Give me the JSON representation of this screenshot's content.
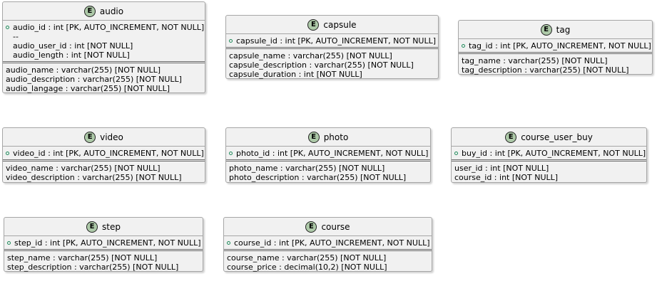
{
  "entities": {
    "audio": {
      "name": "audio",
      "badge": "E",
      "key_fields": [
        "audio_id : int [PK, AUTO_INCREMENT, NOT NULL]"
      ],
      "key_extra": [
        "--",
        "audio_user_id : int [NOT NULL]",
        "audio_length : int [NOT NULL]"
      ],
      "fields": [
        "audio_name : varchar(255) [NOT NULL]",
        "audio_description : varchar(255) [NOT NULL]",
        "audio_langage : varchar(255) [NOT NULL]"
      ]
    },
    "capsule": {
      "name": "capsule",
      "badge": "E",
      "key_fields": [
        "capsule_id : int [PK, AUTO_INCREMENT, NOT NULL]"
      ],
      "fields": [
        "capsule_name : varchar(255) [NOT NULL]",
        "capsule_description : varchar(255) [NOT NULL]",
        "capsule_duration : int [NOT NULL]"
      ]
    },
    "tag": {
      "name": "tag",
      "badge": "E",
      "key_fields": [
        "tag_id : int [PK, AUTO_INCREMENT, NOT NULL]"
      ],
      "fields": [
        "tag_name : varchar(255) [NOT NULL]",
        "tag_description : varchar(255) [NOT NULL]"
      ]
    },
    "video": {
      "name": "video",
      "badge": "E",
      "key_fields": [
        "video_id : int [PK, AUTO_INCREMENT, NOT NULL]"
      ],
      "fields": [
        "video_name : varchar(255) [NOT NULL]",
        "video_description : varchar(255) [NOT NULL]"
      ]
    },
    "photo": {
      "name": "photo",
      "badge": "E",
      "key_fields": [
        "photo_id : int [PK, AUTO_INCREMENT, NOT NULL]"
      ],
      "fields": [
        "photo_name : varchar(255) [NOT NULL]",
        "photo_description : varchar(255) [NOT NULL]"
      ]
    },
    "course_user_buy": {
      "name": "course_user_buy",
      "badge": "E",
      "key_fields": [
        "buy_id : int [PK, AUTO_INCREMENT, NOT NULL]"
      ],
      "fields": [
        "user_id : int [NOT NULL]",
        "course_id : int [NOT NULL]"
      ]
    },
    "step": {
      "name": "step",
      "badge": "E",
      "key_fields": [
        "step_id : int [PK, AUTO_INCREMENT, NOT NULL]"
      ],
      "fields": [
        "step_name : varchar(255) [NOT NULL]",
        "step_description : varchar(255) [NOT NULL]"
      ]
    },
    "course": {
      "name": "course",
      "badge": "E",
      "key_fields": [
        "course_id : int [PK, AUTO_INCREMENT, NOT NULL]"
      ],
      "fields": [
        "course_name : varchar(255) [NOT NULL]",
        "course_price : decimal(10,2) [NOT NULL]"
      ]
    }
  },
  "colors": {
    "entity_fill": "#f1f1f1",
    "entity_border": "#a6a6a6",
    "badge_fill": "#adc9a8",
    "pk_marker": "#1e8a5a"
  }
}
